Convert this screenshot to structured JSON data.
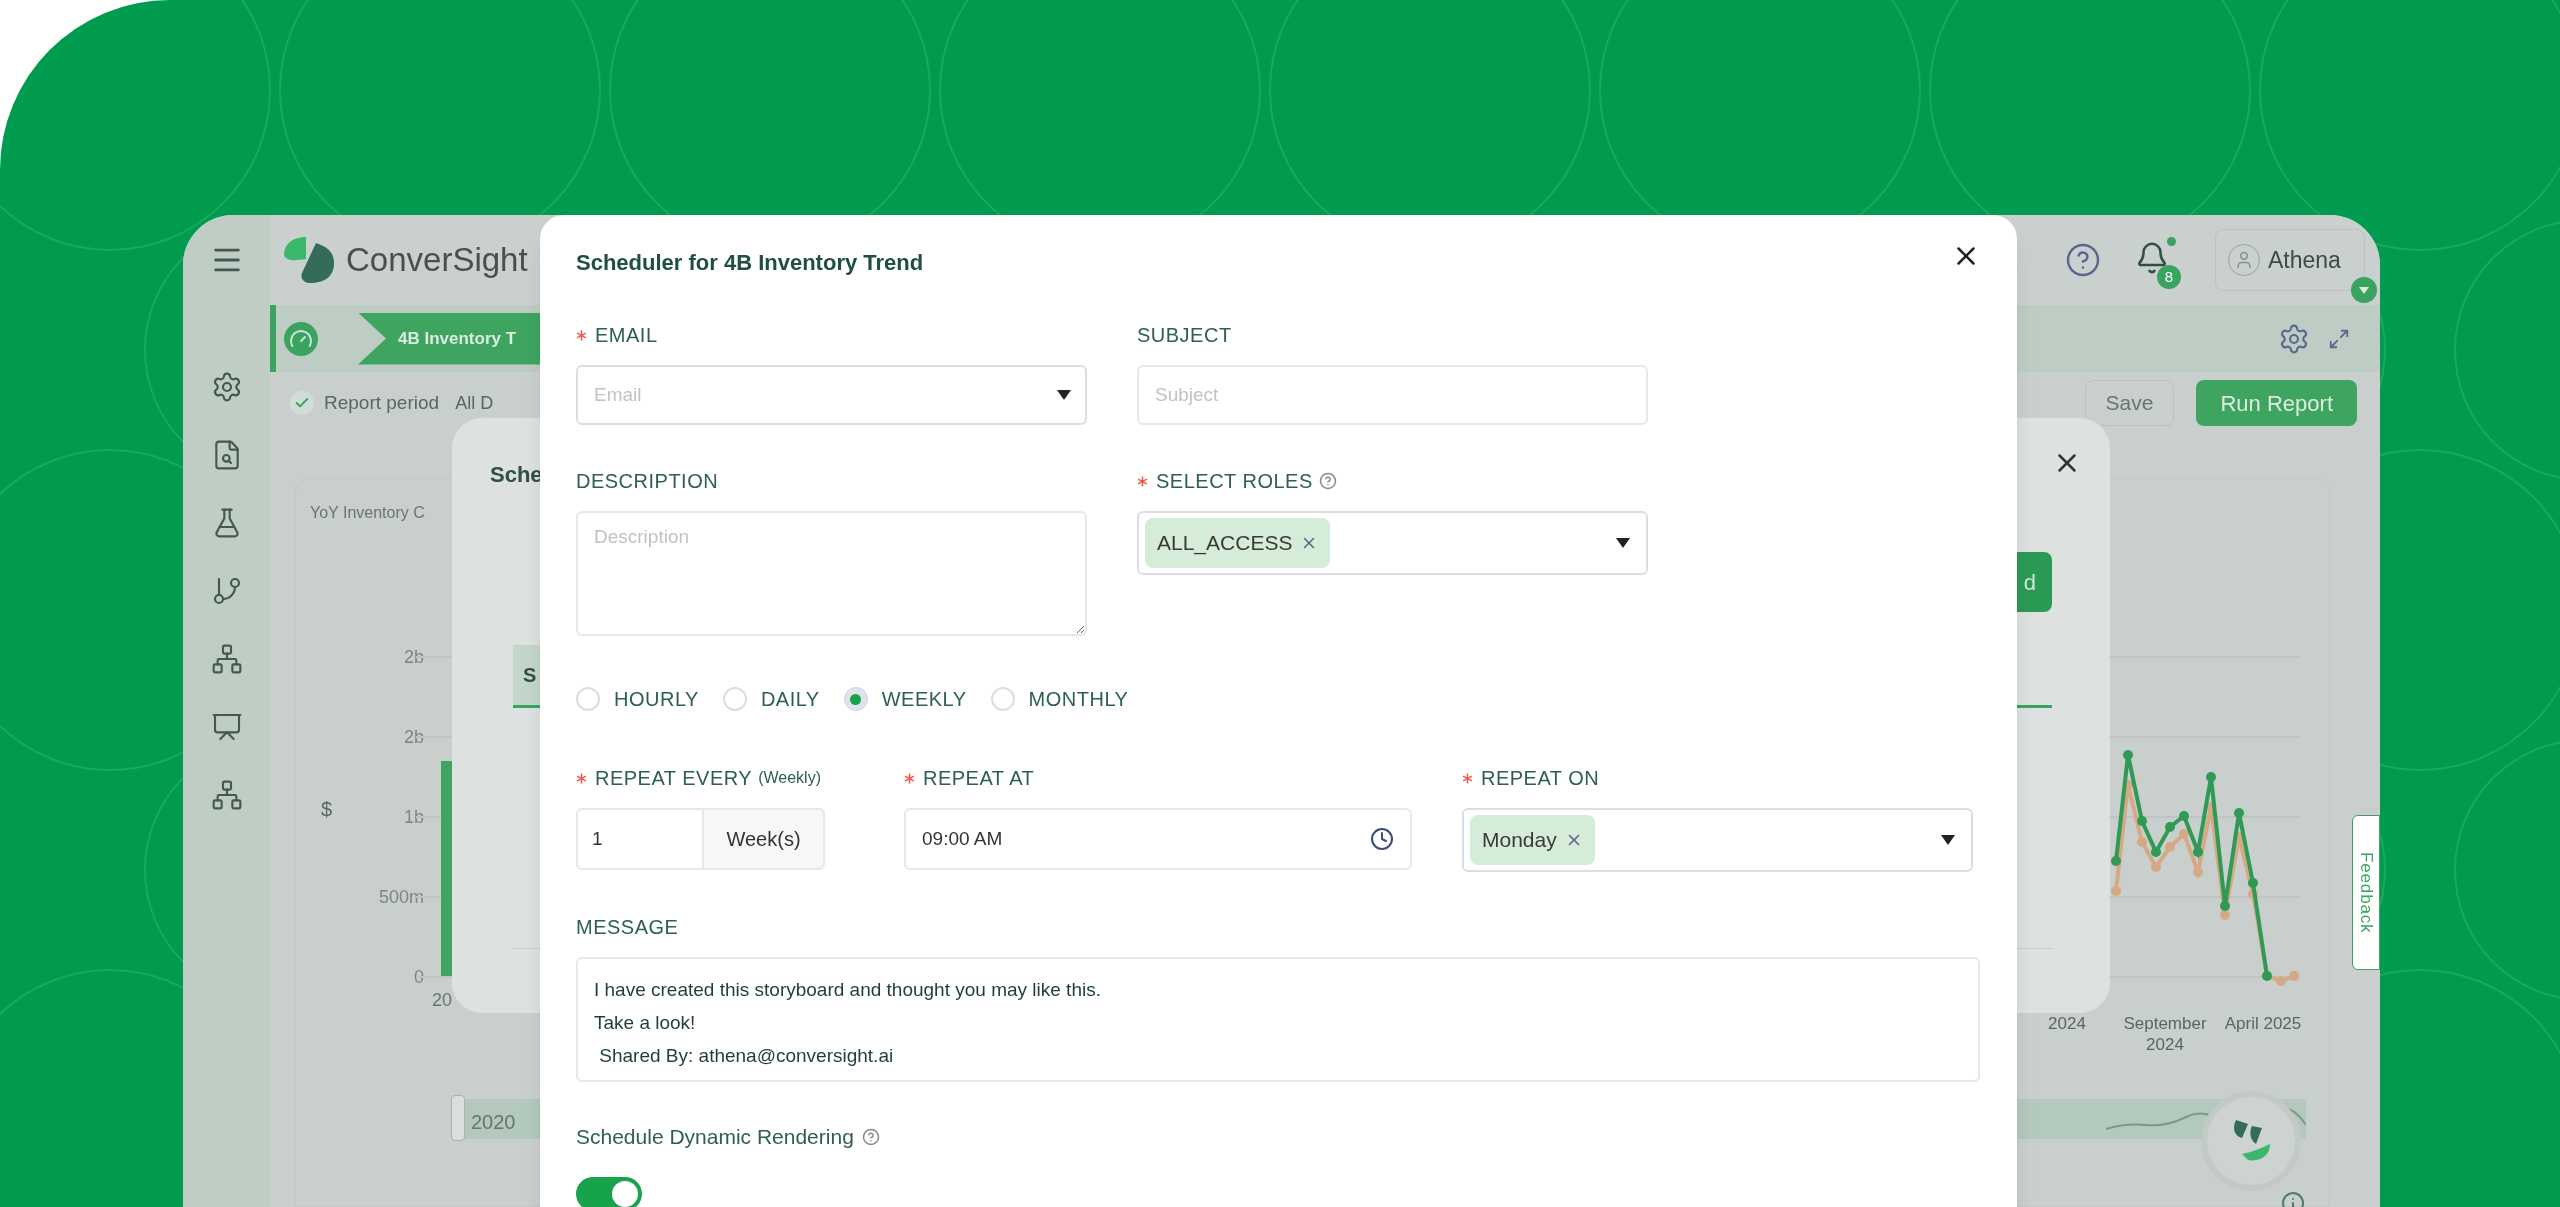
{
  "background_app": {
    "logo_text": "ConverSight",
    "notifications_count": "8",
    "user_name": "Athena",
    "breadcrumb": "4B Inventory T",
    "filter": {
      "label": "Report period",
      "checked": true,
      "value": "All D"
    },
    "buttons": [
      {
        "label": "Save",
        "kind": "outline"
      },
      {
        "label": "Run Report",
        "kind": "primary"
      }
    ],
    "chart": {
      "title": "YoY Inventory C",
      "y_label": "$",
      "y_ticks": [
        "2b",
        "2b",
        "1b",
        "500m",
        "0"
      ],
      "x_start_label": "20",
      "x_labels": [
        "2024",
        "September 2024",
        "April 2025"
      ],
      "range_start": "2020"
    },
    "feedback_tab": "Feedback"
  },
  "background_dialog": {
    "title": "Sche",
    "tab": "S",
    "button": "d"
  },
  "dialog": {
    "title": "Scheduler for 4B Inventory Trend",
    "email": {
      "label": "EMAIL",
      "required": true,
      "placeholder": "Email"
    },
    "subject": {
      "label": "SUBJECT",
      "required": false,
      "placeholder": "Subject"
    },
    "description": {
      "label": "DESCRIPTION",
      "required": false,
      "placeholder": "Description"
    },
    "roles": {
      "label": "SELECT ROLES",
      "required": true,
      "help": true,
      "chips": [
        "ALL_ACCESS"
      ]
    },
    "frequency": [
      {
        "label": "HOURLY",
        "selected": false
      },
      {
        "label": "DAILY",
        "selected": false
      },
      {
        "label": "WEEKLY",
        "selected": true
      },
      {
        "label": "MONTHLY",
        "selected": false
      }
    ],
    "repeat_every": {
      "label": "REPEAT EVERY",
      "hint": "(Weekly)",
      "required": true,
      "value": "1",
      "unit": "Week(s)"
    },
    "repeat_at": {
      "label": "REPEAT AT",
      "required": true,
      "value": "09:00 AM"
    },
    "repeat_on": {
      "label": "REPEAT ON",
      "required": true,
      "chips": [
        "Monday"
      ]
    },
    "message": {
      "label": "MESSAGE",
      "value": "I have created this storyboard and thought you may like this.\nTake a look!\n Shared By: athena@conversight.ai"
    },
    "dynamic_rendering": {
      "label": "Schedule Dynamic Rendering",
      "help": true,
      "on": true
    }
  }
}
